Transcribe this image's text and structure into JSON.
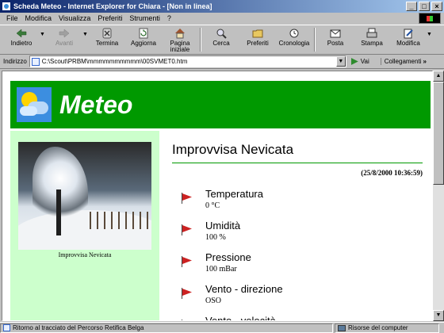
{
  "window": {
    "title": "Scheda Meteo - Internet Explorer for Chiara - [Non in linea]"
  },
  "menu": [
    {
      "label": "File"
    },
    {
      "label": "Modifica"
    },
    {
      "label": "Visualizza"
    },
    {
      "label": "Preferiti"
    },
    {
      "label": "Strumenti"
    },
    {
      "label": "?"
    }
  ],
  "toolbar": {
    "back": "Indietro",
    "forward": "Avanti",
    "stop": "Termina",
    "refresh": "Aggiorna",
    "home": "Pagina iniziale",
    "search": "Cerca",
    "favorites": "Preferiti",
    "history": "Cronologia",
    "mail": "Posta",
    "print": "Stampa",
    "edit": "Modifica"
  },
  "address": {
    "label": "Indirizzo",
    "url": "C:\\Scout\\PRBM\\mmmmmmmmmm\\00SVMET0.htm",
    "go": "Vai",
    "links": "Collegamenti"
  },
  "page": {
    "banner_title": "Meteo",
    "caption": "Improvvisa Nevicata",
    "heading": "Improvvisa Nevicata",
    "timestamp": "(25/8/2000 10:36:59)",
    "items": [
      {
        "label": "Temperatura",
        "value": "0 °C"
      },
      {
        "label": "Umidità",
        "value": "100 %"
      },
      {
        "label": "Pressione",
        "value": "100 mBar"
      },
      {
        "label": "Vento - direzione",
        "value": "OSO"
      },
      {
        "label": "Vento - velocità",
        "value": ""
      }
    ]
  },
  "status": {
    "message": "Ritorno al tracciato del Percorso Retifica Belga",
    "zone": "Risorse del computer"
  },
  "colors": {
    "banner": "#009900",
    "left_panel": "#ccffcc",
    "titlebar": "#0a246a"
  }
}
